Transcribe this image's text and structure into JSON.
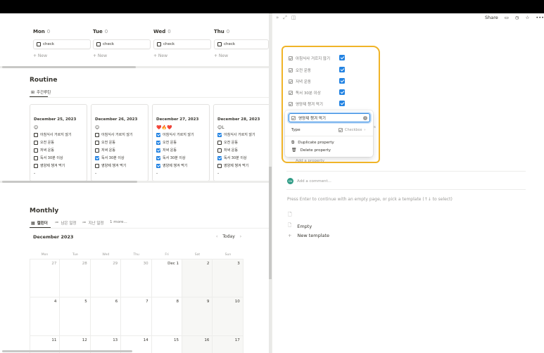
{
  "weekview": {
    "days": [
      {
        "label": "Mon",
        "count": "0",
        "card": "check",
        "new": "+ New"
      },
      {
        "label": "Tue",
        "count": "0",
        "card": "check",
        "new": "+ New"
      },
      {
        "label": "Wed",
        "count": "0",
        "card": "check",
        "new": "+ New"
      },
      {
        "label": "Thu",
        "count": "0",
        "card": "check",
        "new": "+ New"
      }
    ]
  },
  "routine": {
    "title": "Routine",
    "view_tab": "주간루틴",
    "cards": [
      {
        "date": "December 25, 2023",
        "emoji": "😊",
        "items": [
          {
            "label": "아침식사 거르지 않기",
            "checked": false
          },
          {
            "label": "오전 운동",
            "checked": false
          },
          {
            "label": "저녁 운동",
            "checked": false
          },
          {
            "label": "독서 30분 이상",
            "checked": false
          },
          {
            "label": "영양제 챙겨 먹기",
            "checked": false
          }
        ],
        "dash": "-"
      },
      {
        "date": "December 26, 2023",
        "emoji": "😊",
        "items": [
          {
            "label": "아침식사 거르지 않기",
            "checked": false
          },
          {
            "label": "오전 운동",
            "checked": false
          },
          {
            "label": "저녁 운동",
            "checked": false
          },
          {
            "label": "독서 30분 이상",
            "checked": true
          },
          {
            "label": "영양제 챙겨 먹기",
            "checked": false
          }
        ],
        "dash": "-"
      },
      {
        "date": "December 27, 2023",
        "emoji": "❤️🔥❤️",
        "items": [
          {
            "label": "아침식사 거르지 않기",
            "checked": true
          },
          {
            "label": "오전 운동",
            "checked": true
          },
          {
            "label": "저녁 운동",
            "checked": true
          },
          {
            "label": "독서 30분 이상",
            "checked": true
          },
          {
            "label": "영양제 챙겨 먹기",
            "checked": true
          }
        ],
        "dash": "-"
      },
      {
        "date": "December 28, 2023",
        "emoji": "😊L",
        "items": [
          {
            "label": "아침식사 거르지 않기",
            "checked": true
          },
          {
            "label": "오전 운동",
            "checked": false
          },
          {
            "label": "저녁 운동",
            "checked": false
          },
          {
            "label": "독서 30분 이상",
            "checked": true
          },
          {
            "label": "영양제 챙겨 먹기",
            "checked": false
          }
        ],
        "dash": "-"
      }
    ]
  },
  "monthly": {
    "title": "Monthly",
    "tabs": [
      "캘린더",
      "남은 일정",
      "지난 일정",
      "1 more..."
    ],
    "month": "December 2023",
    "today": "Today",
    "weekdays": [
      "Mon",
      "Tue",
      "Wed",
      "Thu",
      "Fri",
      "Sat",
      "Sun"
    ],
    "rows": [
      [
        "27",
        "28",
        "29",
        "30",
        "Dec 1",
        "2",
        "3"
      ],
      [
        "4",
        "5",
        "6",
        "7",
        "8",
        "9",
        "10"
      ],
      [
        "11",
        "12",
        "13",
        "14",
        "15",
        "16",
        "17"
      ]
    ]
  },
  "side_peek": {
    "share": "Share",
    "properties": [
      {
        "label": "아침식사 거르지 않기",
        "checked": true
      },
      {
        "label": "오전 운동",
        "checked": true
      },
      {
        "label": "저녁 운동",
        "checked": true
      },
      {
        "label": "독서 30분 이상",
        "checked": true
      },
      {
        "label": "영양제 챙겨 먹기",
        "checked": true
      }
    ],
    "popup": {
      "name_value": "영양제 챙겨 먹기",
      "type_label": "Type",
      "type_value": "Checkbox",
      "duplicate": "Duplicate property",
      "delete": "Delete property"
    },
    "add_property": "Add a property",
    "add_comment": "Add a comment...",
    "hint": "Press Enter to continue with an empty page, or pick a template (↑↓ to select)",
    "empty": "Empty",
    "new_template": "New template",
    "avatar_initials": "SW"
  },
  "colors": {
    "accent": "#2383e2",
    "highlight": "#f0b428"
  }
}
